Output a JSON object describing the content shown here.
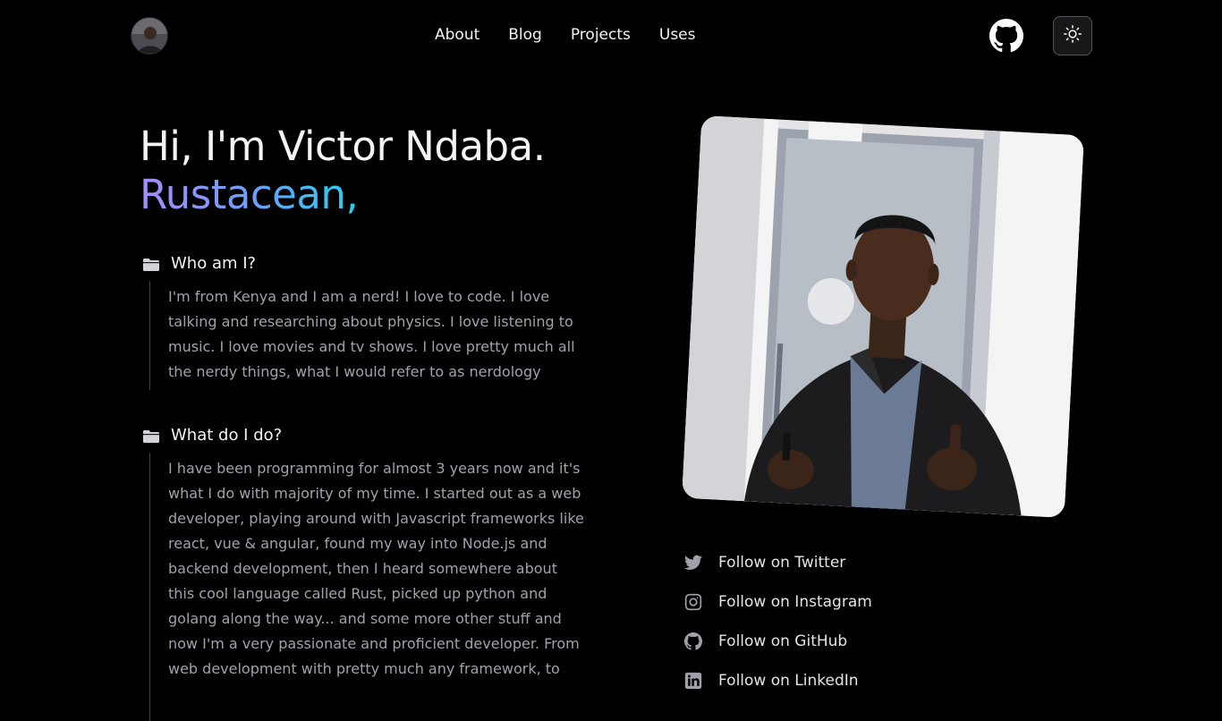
{
  "header": {
    "nav": [
      {
        "label": "About"
      },
      {
        "label": "Blog"
      },
      {
        "label": "Projects"
      },
      {
        "label": "Uses"
      }
    ],
    "github_icon": "github-icon",
    "theme_icon": "sun-icon"
  },
  "hero": {
    "title": "Hi, I'm Victor Ndaba.",
    "role": "Rustacean,"
  },
  "sections": [
    {
      "title": "Who am I?",
      "icon": "folder-icon",
      "body": "I'm from Kenya and I am a nerd! I love to code. I love talking and researching about physics. I love listening to music. I love movies and tv shows. I love pretty much all the nerdy things, what I would refer to as nerdology"
    },
    {
      "title": "What do I do?",
      "icon": "folder-icon",
      "body": "I have been programming for almost 3 years now and it's what I do with majority of my time. I started out as a web developer, playing around with Javascript frameworks like react, vue & angular, found my way into Node.js and backend development, then I heard somewhere about this cool language called Rust, picked up python and golang along the way... and some more other stuff and now I'm a very passionate and proficient developer. From web development with pretty much any framework, to"
    }
  ],
  "socials": [
    {
      "label": "Follow on Twitter",
      "icon": "twitter-icon"
    },
    {
      "label": "Follow on Instagram",
      "icon": "instagram-icon"
    },
    {
      "label": "Follow on GitHub",
      "icon": "github-icon"
    },
    {
      "label": "Follow on LinkedIn",
      "icon": "linkedin-icon"
    }
  ],
  "colors": {
    "background": "#000000",
    "text": "#f4f4f5",
    "muted": "#a1a1aa",
    "gradient_start": "#a78bfa",
    "gradient_end": "#22d3ee"
  }
}
